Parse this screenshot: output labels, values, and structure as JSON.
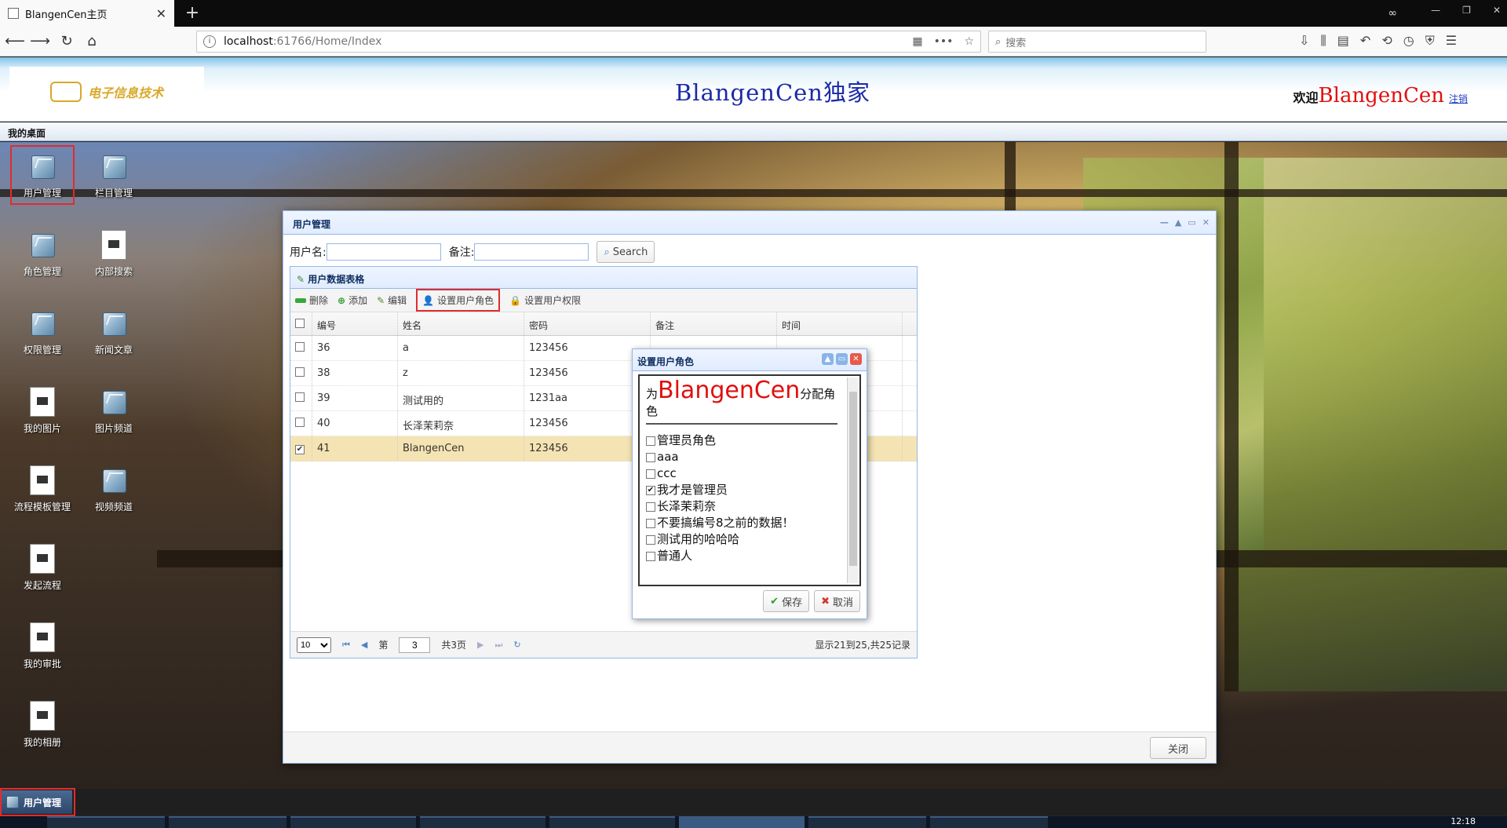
{
  "browser": {
    "tab_title": "BlangenCen主页",
    "tab_close": "✕",
    "new_tab": "+",
    "url_host": "localhost",
    "url_path": ":61766/Home/Index",
    "search_placeholder": "搜索"
  },
  "header": {
    "logo_text": "电子信息技术",
    "site_title": "BlangenCen独家",
    "welcome_label": "欢迎",
    "username": "BlangenCen",
    "logout": "注销"
  },
  "deskbar": {
    "label": "我的桌面"
  },
  "desktop_icons": [
    {
      "label": "用户管理"
    },
    {
      "label": "栏目管理"
    },
    {
      "label": "角色管理"
    },
    {
      "label": "内部搜索"
    },
    {
      "label": "权限管理"
    },
    {
      "label": "新闻文章"
    },
    {
      "label": "我的图片"
    },
    {
      "label": "图片频道"
    },
    {
      "label": "流程模板管理"
    },
    {
      "label": "视频频道"
    },
    {
      "label": "发起流程"
    },
    {
      "label": "我的审批"
    },
    {
      "label": "我的相册"
    }
  ],
  "window": {
    "title": "用户管理",
    "filter_user_label": "用户名:",
    "filter_note_label": "备注:",
    "search_button": "Search",
    "close_button": "关闭"
  },
  "grid": {
    "title": "用户数据表格",
    "toolbar": {
      "delete": "删除",
      "add": "添加",
      "edit": "编辑",
      "set_role": "设置用户角色",
      "set_permission": "设置用户权限"
    },
    "columns": [
      "编号",
      "姓名",
      "密码",
      "备注",
      "时间"
    ],
    "rows": [
      {
        "id": "36",
        "name": "a",
        "password": "123456",
        "note": "",
        "time": "",
        "checked": false
      },
      {
        "id": "38",
        "name": "z",
        "password": "123456",
        "note": "",
        "time": "",
        "checked": false
      },
      {
        "id": "39",
        "name": "测试用的",
        "password": "1231aa",
        "note": "",
        "time": "",
        "checked": false
      },
      {
        "id": "40",
        "name": "长泽茉莉奈",
        "password": "123456",
        "note": "",
        "time": "",
        "checked": false
      },
      {
        "id": "41",
        "name": "BlangenCen",
        "password": "123456",
        "note": "",
        "time": "",
        "checked": true
      }
    ],
    "pager": {
      "page_size": "10",
      "page_label": "第",
      "page_value": "3",
      "total_pages": "共3页",
      "info": "显示21到25,共25记录"
    }
  },
  "role_dialog": {
    "title": "设置用户角色",
    "prefix": "为",
    "user": "BlangenCen",
    "suffix": "分配角色",
    "roles": [
      {
        "label": "管理员角色",
        "checked": false
      },
      {
        "label": "aaa",
        "checked": false
      },
      {
        "label": "ccc",
        "checked": false
      },
      {
        "label": "我才是管理员",
        "checked": true
      },
      {
        "label": "长泽茉莉奈",
        "checked": false
      },
      {
        "label": "不要搞编号8之前的数据！",
        "checked": false
      },
      {
        "label": "测试用的哈哈哈",
        "checked": false
      },
      {
        "label": "普通人",
        "checked": false
      }
    ],
    "save": "保存",
    "cancel": "取消"
  },
  "app_taskbar": {
    "active": "用户管理"
  },
  "os_taskbar": {
    "clock": "12:18"
  },
  "colors": {
    "highlight_box": "#e32b2b",
    "panel_border": "#95b8e7",
    "selected_row": "#f5e4b3",
    "title_blue": "#1a2aa8",
    "username_red": "#e01010"
  }
}
